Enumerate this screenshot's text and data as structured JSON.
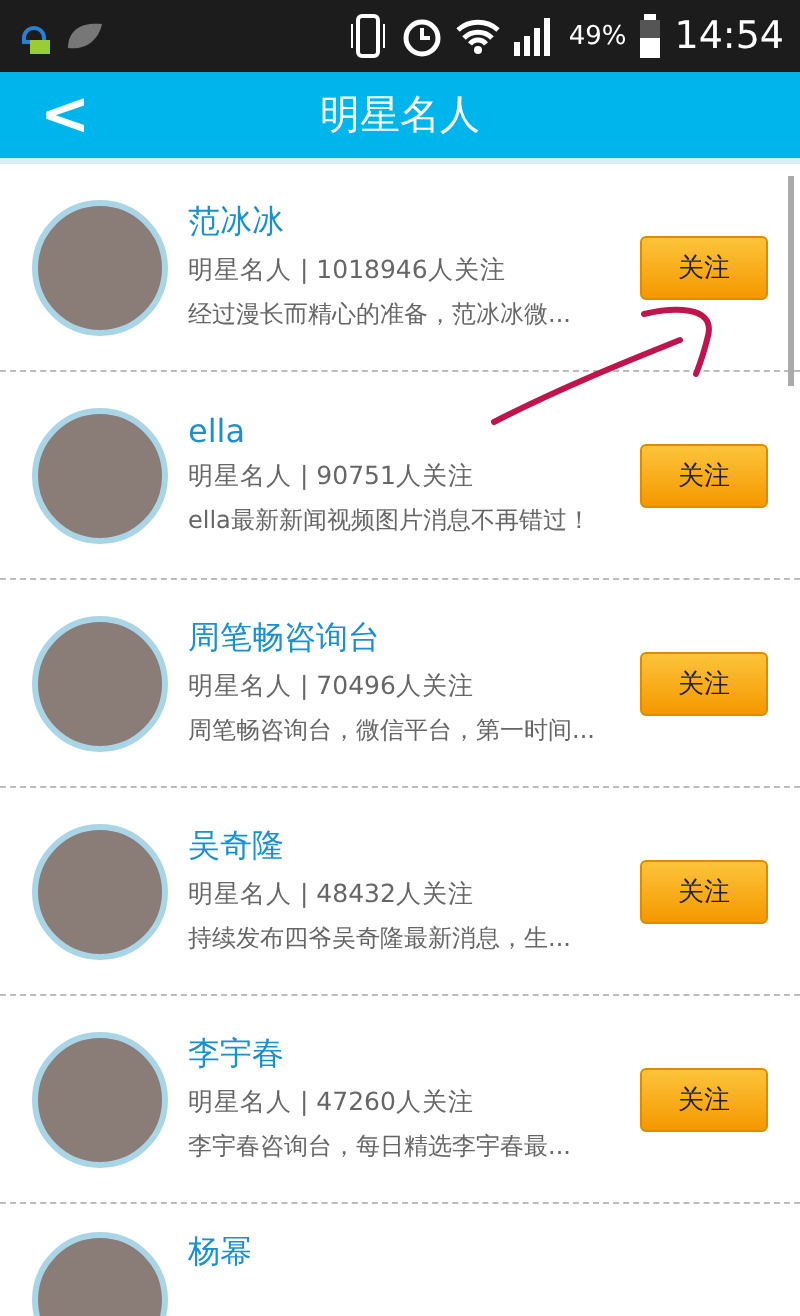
{
  "status_bar": {
    "battery": "49%",
    "time": "14:54"
  },
  "header": {
    "back": "<",
    "title": "明星名人"
  },
  "items": [
    {
      "name": "范冰冰",
      "meta": "明星名人 | 1018946人关注",
      "desc": "经过漫长而精心的准备，范冰冰微...",
      "button": "关注"
    },
    {
      "name": "ella",
      "meta": "明星名人 | 90751人关注",
      "desc": "ella最新新闻视频图片消息不再错过！",
      "button": "关注"
    },
    {
      "name": "周笔畅咨询台",
      "meta": "明星名人 | 70496人关注",
      "desc": "周笔畅咨询台，微信平台，第一时间...",
      "button": "关注"
    },
    {
      "name": "吴奇隆",
      "meta": "明星名人 | 48432人关注",
      "desc": "持续发布四爷吴奇隆最新消息，生...",
      "button": "关注"
    },
    {
      "name": "李宇春",
      "meta": "明星名人 | 47260人关注",
      "desc": "李宇春咨询台，每日精选李宇春最...",
      "button": "关注"
    },
    {
      "name": "杨幂"
    }
  ]
}
